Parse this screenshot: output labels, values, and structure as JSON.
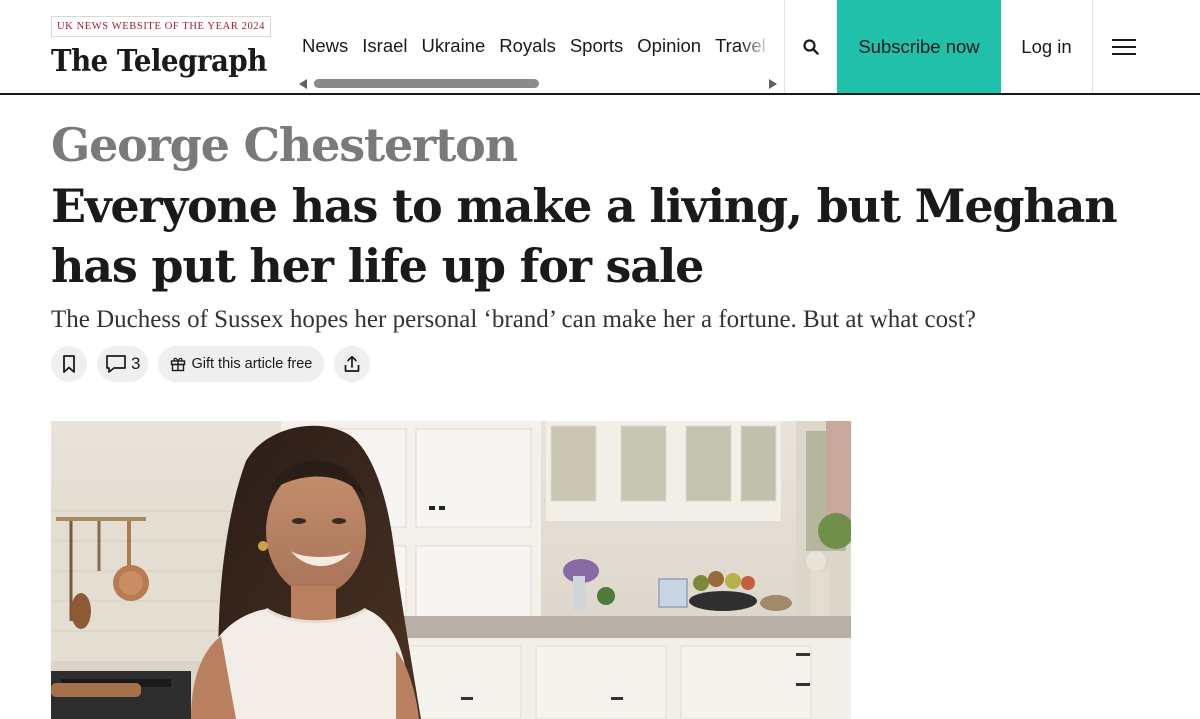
{
  "header": {
    "award": "UK NEWS WEBSITE OF THE YEAR 2024",
    "logo": "The Telegraph",
    "nav": [
      "News",
      "Israel",
      "Ukraine",
      "Royals",
      "Sports",
      "Opinion",
      "Travel"
    ],
    "search_icon": "search-icon",
    "subscribe_label": "Subscribe now",
    "subscribe_color": "#20c0aa",
    "login_label": "Log in",
    "menu_icon": "hamburger-menu-icon"
  },
  "article": {
    "byline": "George Chesterton",
    "headline": "Everyone has to make a living, but Meghan has put her life up for sale",
    "standfirst": "The Duchess of Sussex hopes her personal ‘brand’ can make her a fortune. But at what cost?",
    "actions": {
      "bookmark_icon": "bookmark-icon",
      "comment_icon": "comment-icon",
      "comment_count": "3",
      "gift_icon": "gift-icon",
      "gift_label": "Gift this article free",
      "share_icon": "share-icon"
    }
  }
}
